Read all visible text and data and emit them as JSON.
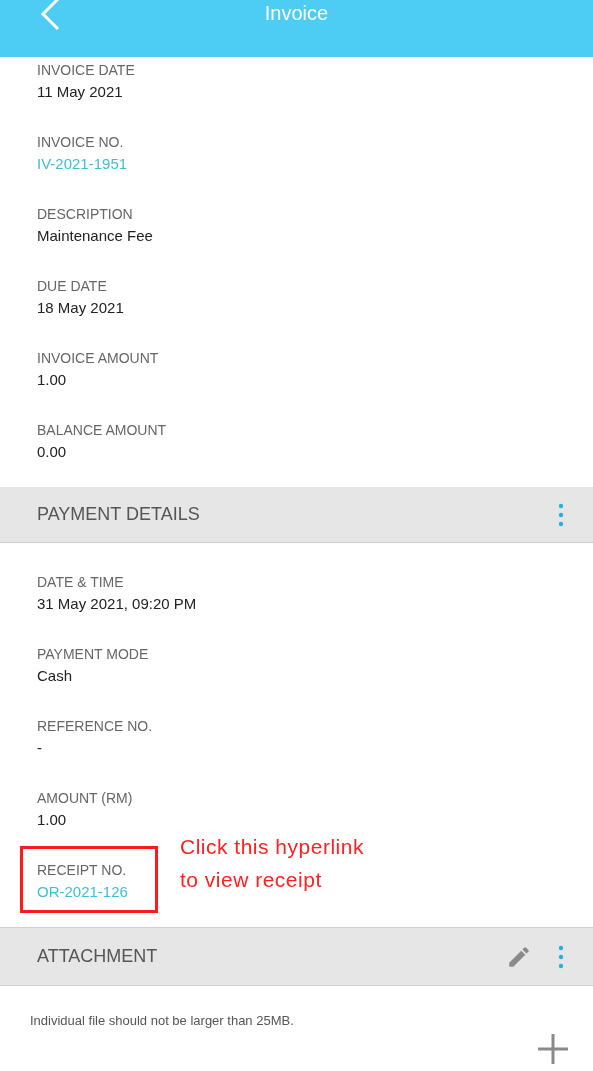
{
  "app_bar": {
    "title": "Invoice"
  },
  "invoice_fields": [
    {
      "label": "INVOICE DATE",
      "value": "11 May 2021",
      "kind": "text"
    },
    {
      "label": "INVOICE NO.",
      "value": "IV-2021-1951",
      "kind": "link"
    },
    {
      "label": "DESCRIPTION",
      "value": "Maintenance Fee",
      "kind": "text"
    },
    {
      "label": "DUE DATE",
      "value": "18 May 2021",
      "kind": "text"
    },
    {
      "label": "INVOICE AMOUNT",
      "value": "1.00",
      "kind": "text"
    },
    {
      "label": "BALANCE AMOUNT",
      "value": "0.00",
      "kind": "text"
    }
  ],
  "payment_section": {
    "title": "PAYMENT DETAILS"
  },
  "payment_fields": [
    {
      "label": "DATE & TIME",
      "value": "31 May 2021, 09:20 PM",
      "kind": "text",
      "highlighted": false
    },
    {
      "label": "PAYMENT MODE",
      "value": "Cash",
      "kind": "text",
      "highlighted": false
    },
    {
      "label": "REFERENCE NO.",
      "value": "-",
      "kind": "text",
      "highlighted": false
    },
    {
      "label": "AMOUNT (RM)",
      "value": "1.00",
      "kind": "text",
      "highlighted": false
    },
    {
      "label": "RECEIPT NO.",
      "value": "OR-2021-126",
      "kind": "link",
      "highlighted": true
    }
  ],
  "annotation": {
    "lines": [
      "Click this hyperlink",
      "to view receipt"
    ]
  },
  "attachment_section": {
    "title": "ATTACHMENT",
    "note": "Individual file should not be larger than 25MB."
  }
}
